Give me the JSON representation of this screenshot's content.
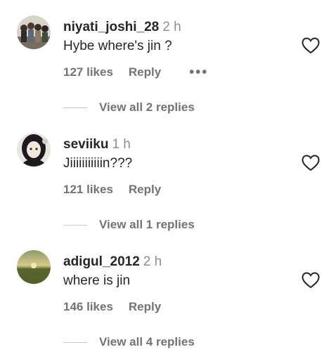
{
  "colors": {
    "text": "#262626",
    "secondary": "#737373",
    "muted": "#8e8e8e",
    "divider": "#c7c7c7"
  },
  "comments": [
    {
      "username": "niyati_joshi_28",
      "time": "2 h",
      "text": "Hybe where's jin ?",
      "likes": "127 likes",
      "reply_label": "Reply",
      "more_label": "•••",
      "view_replies": "View all 2 replies",
      "avatar_icon": "group-photo-avatar",
      "like_icon": "heart-outline-icon"
    },
    {
      "username": "seviiku",
      "time": "1 h",
      "text": "Jiiiiiiiiiiin???",
      "likes": "121 likes",
      "reply_label": "Reply",
      "view_replies": "View all 1 replies",
      "avatar_icon": "anime-girl-avatar",
      "like_icon": "heart-outline-icon"
    },
    {
      "username": "adigul_2012",
      "time": "2 h",
      "text": "where is jin",
      "likes": "146 likes",
      "reply_label": "Reply",
      "view_replies": "View all 4 replies",
      "avatar_icon": "landscape-avatar",
      "like_icon": "heart-outline-icon"
    }
  ]
}
